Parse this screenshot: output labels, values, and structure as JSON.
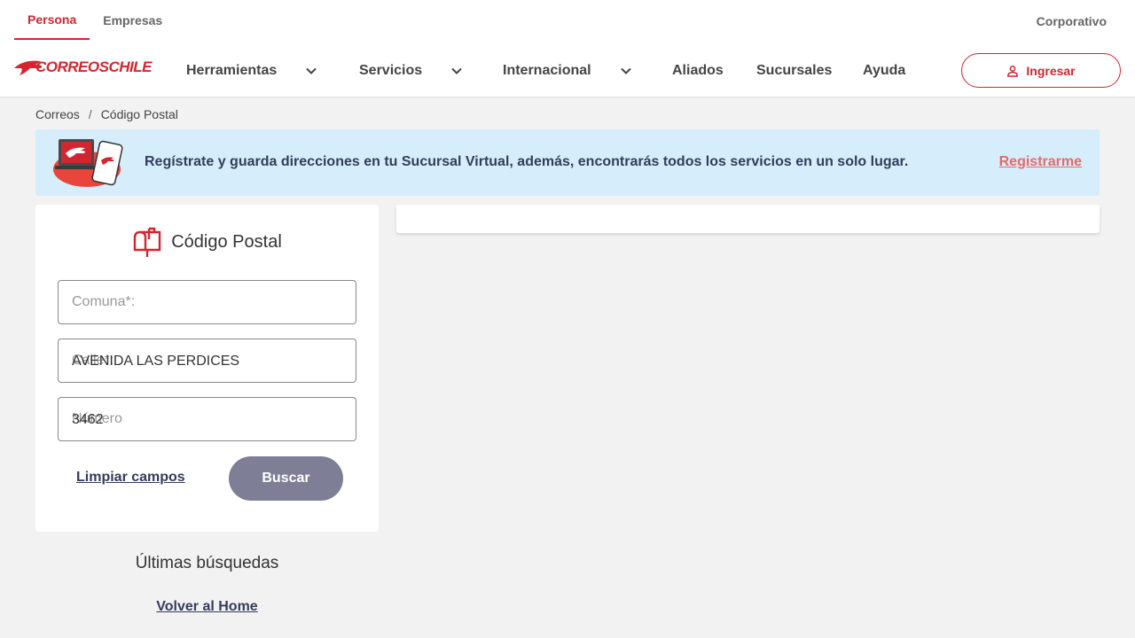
{
  "header": {
    "segments": [
      {
        "label": "Persona",
        "active": true
      },
      {
        "label": "Empresas",
        "active": false
      }
    ],
    "corporate_link": "Corporativo",
    "logo_text": "CORREOSCHILE",
    "nav": [
      {
        "label": "Herramientas",
        "has_dropdown": true
      },
      {
        "label": "Servicios",
        "has_dropdown": true
      },
      {
        "label": "Internacional",
        "has_dropdown": true
      },
      {
        "label": "Aliados",
        "has_dropdown": false
      },
      {
        "label": "Sucursales",
        "has_dropdown": false
      },
      {
        "label": "Ayuda",
        "has_dropdown": false
      }
    ],
    "login_label": "Ingresar",
    "login_icon": "user-icon"
  },
  "breadcrumb": {
    "items": [
      "Correos",
      "Código Postal"
    ],
    "separator": "/"
  },
  "banner": {
    "message": "Regístrate y guarda direcciones en tu Sucursal Virtual, además, encontrarás todos los servicios en un solo lugar.",
    "link_label": "Registrarme"
  },
  "form": {
    "title": "Código Postal",
    "title_icon": "mailbox-icon",
    "fields": {
      "comuna": {
        "placeholder": "Comuna*:",
        "value": ""
      },
      "calle": {
        "placeholder": "Calle*:",
        "value": "AVENIDA LAS PERDICES"
      },
      "numero": {
        "placeholder": "Número",
        "value": "3462"
      }
    },
    "clear_label": "Limpiar campos",
    "search_label": "Buscar"
  },
  "recent": {
    "title": "Últimas búsquedas",
    "back_home_label": "Volver al Home"
  },
  "colors": {
    "brand_red": "#d22630",
    "banner_bg": "#d6eefb",
    "search_button": "#7e7f96",
    "navy_text": "#333c5c",
    "page_bg": "#f2f2f2"
  }
}
